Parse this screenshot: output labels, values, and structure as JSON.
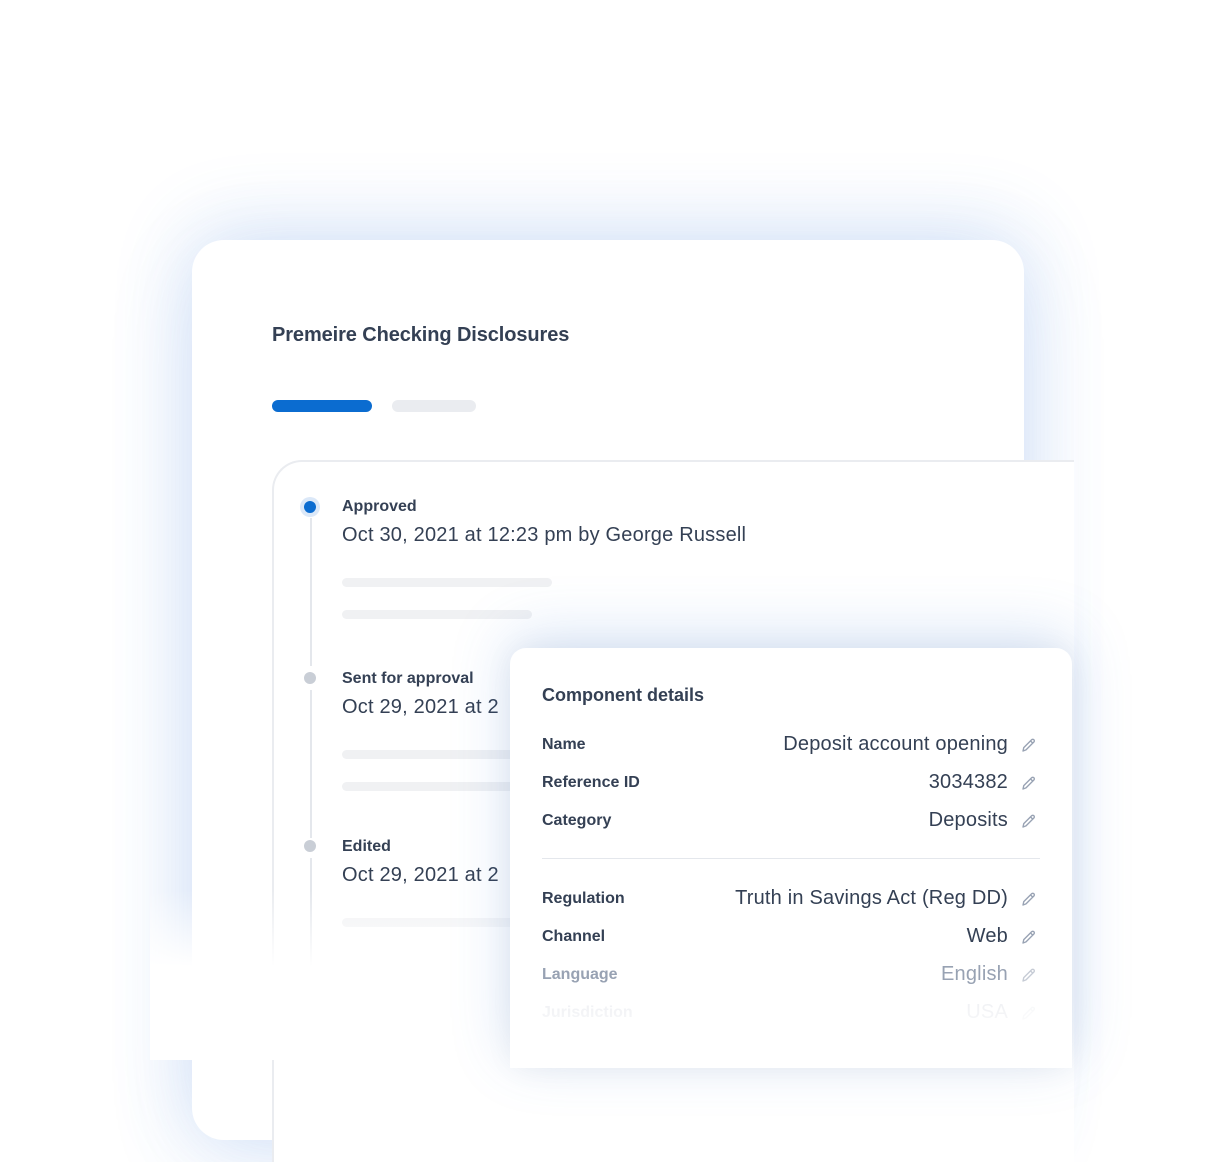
{
  "document": {
    "title": "Premeire Checking Disclosures"
  },
  "tabs": [
    {
      "state": "active"
    },
    {
      "state": "inactive"
    }
  ],
  "timeline": [
    {
      "label": "Approved",
      "date": "Oct 30, 2021 at 12:23 pm by George Russell",
      "status": "active"
    },
    {
      "label": "Sent for approval",
      "date": "Oct 29, 2021 at 2",
      "status": "inactive"
    },
    {
      "label": "Edited",
      "date": "Oct 29, 2021 at 2",
      "status": "inactive"
    }
  ],
  "details": {
    "title": "Component details",
    "rows": [
      {
        "label": "Name",
        "value": "Deposit account opening"
      },
      {
        "label": "Reference ID",
        "value": "3034382"
      },
      {
        "label": "Category",
        "value": "Deposits"
      },
      {
        "label": "Regulation",
        "value": "Truth in Savings Act (Reg DD)"
      },
      {
        "label": "Channel",
        "value": "Web"
      },
      {
        "label": "Language",
        "value": "English"
      },
      {
        "label": "Jurisdiction",
        "value": "USA"
      }
    ]
  },
  "colors": {
    "accent": "#0b6cd0",
    "text": "#344054",
    "muted": "#98a2b3",
    "skeleton": "#f0f1f3"
  },
  "icons": {
    "edit": "pencil-icon"
  }
}
